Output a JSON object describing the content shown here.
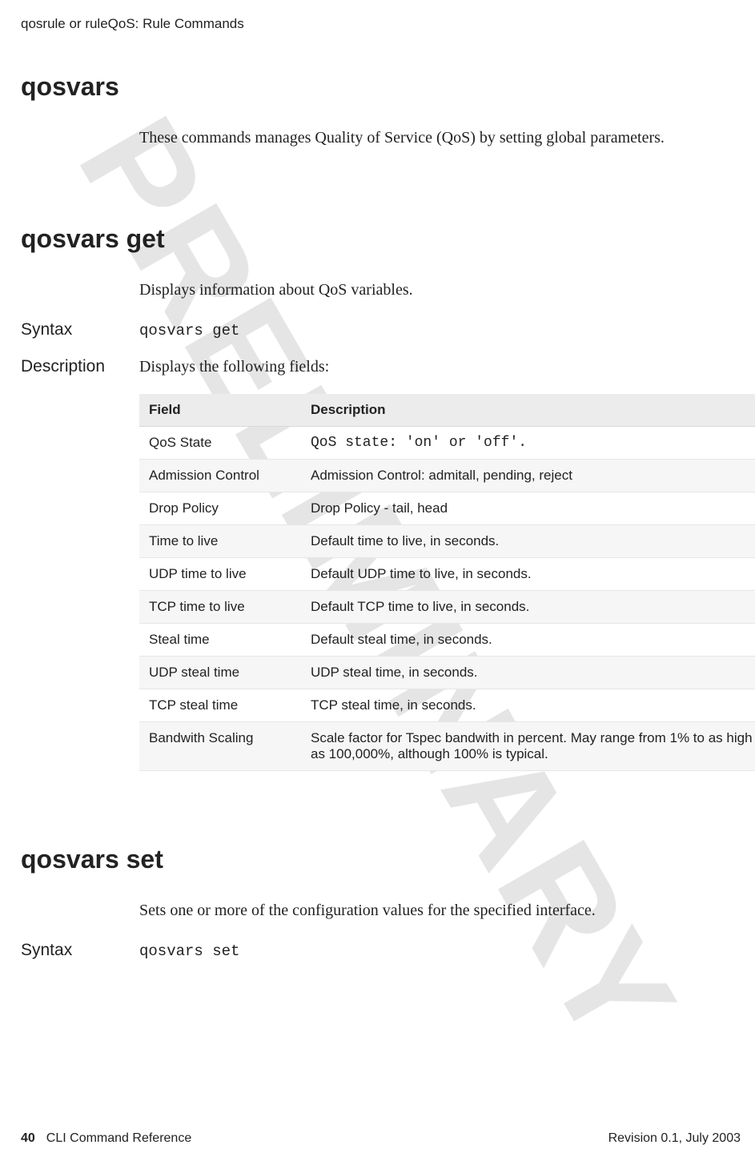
{
  "running_head": "qosrule or ruleQoS: Rule Commands",
  "watermark": "PRELIMINARY",
  "sections": {
    "qosvars": {
      "title": "qosvars",
      "intro": "These commands manages Quality of Service (QoS) by setting global parameters."
    },
    "qosvars_get": {
      "title": "qosvars get",
      "intro": "Displays information about QoS variables.",
      "syntax_label": "Syntax",
      "syntax_cmd": "qosvars get",
      "description_label": "Description",
      "description_text": "Displays the following fields:",
      "table": {
        "headers": [
          "Field",
          "Description"
        ],
        "rows": [
          {
            "field": "QoS State",
            "desc": "QoS state: 'on' or 'off'.",
            "mono": true,
            "alt": false
          },
          {
            "field": "Admission Control",
            "desc": "Admission Control: admitall, pending, reject",
            "mono": false,
            "alt": true
          },
          {
            "field": "Drop Policy",
            "desc": "Drop Policy - tail, head",
            "mono": false,
            "alt": false
          },
          {
            "field": "Time to live",
            "desc": "Default time to live, in seconds.",
            "mono": false,
            "alt": true
          },
          {
            "field": "UDP time to live",
            "desc": "Default UDP time to live, in seconds.",
            "mono": false,
            "alt": false
          },
          {
            "field": "TCP time to live",
            "desc": "Default TCP time to live, in seconds.",
            "mono": false,
            "alt": true
          },
          {
            "field": "Steal time",
            "desc": "Default steal time, in seconds.",
            "mono": false,
            "alt": false
          },
          {
            "field": "UDP steal time",
            "desc": "UDP steal time, in seconds.",
            "mono": false,
            "alt": true
          },
          {
            "field": "TCP steal time",
            "desc": "TCP steal time, in seconds.",
            "mono": false,
            "alt": false
          },
          {
            "field": "Bandwith Scaling",
            "desc": "Scale factor for Tspec bandwith in percent. May range from 1% to as high as 100,000%, although 100% is typical.",
            "mono": false,
            "alt": true
          }
        ]
      }
    },
    "qosvars_set": {
      "title": "qosvars set",
      "intro": "Sets one or more of the configuration values for the specified interface.",
      "syntax_label": "Syntax",
      "syntax_cmd": "qosvars set"
    }
  },
  "footer": {
    "page_number": "40",
    "doc_title": "CLI Command Reference",
    "revision": "Revision 0.1, July 2003"
  }
}
